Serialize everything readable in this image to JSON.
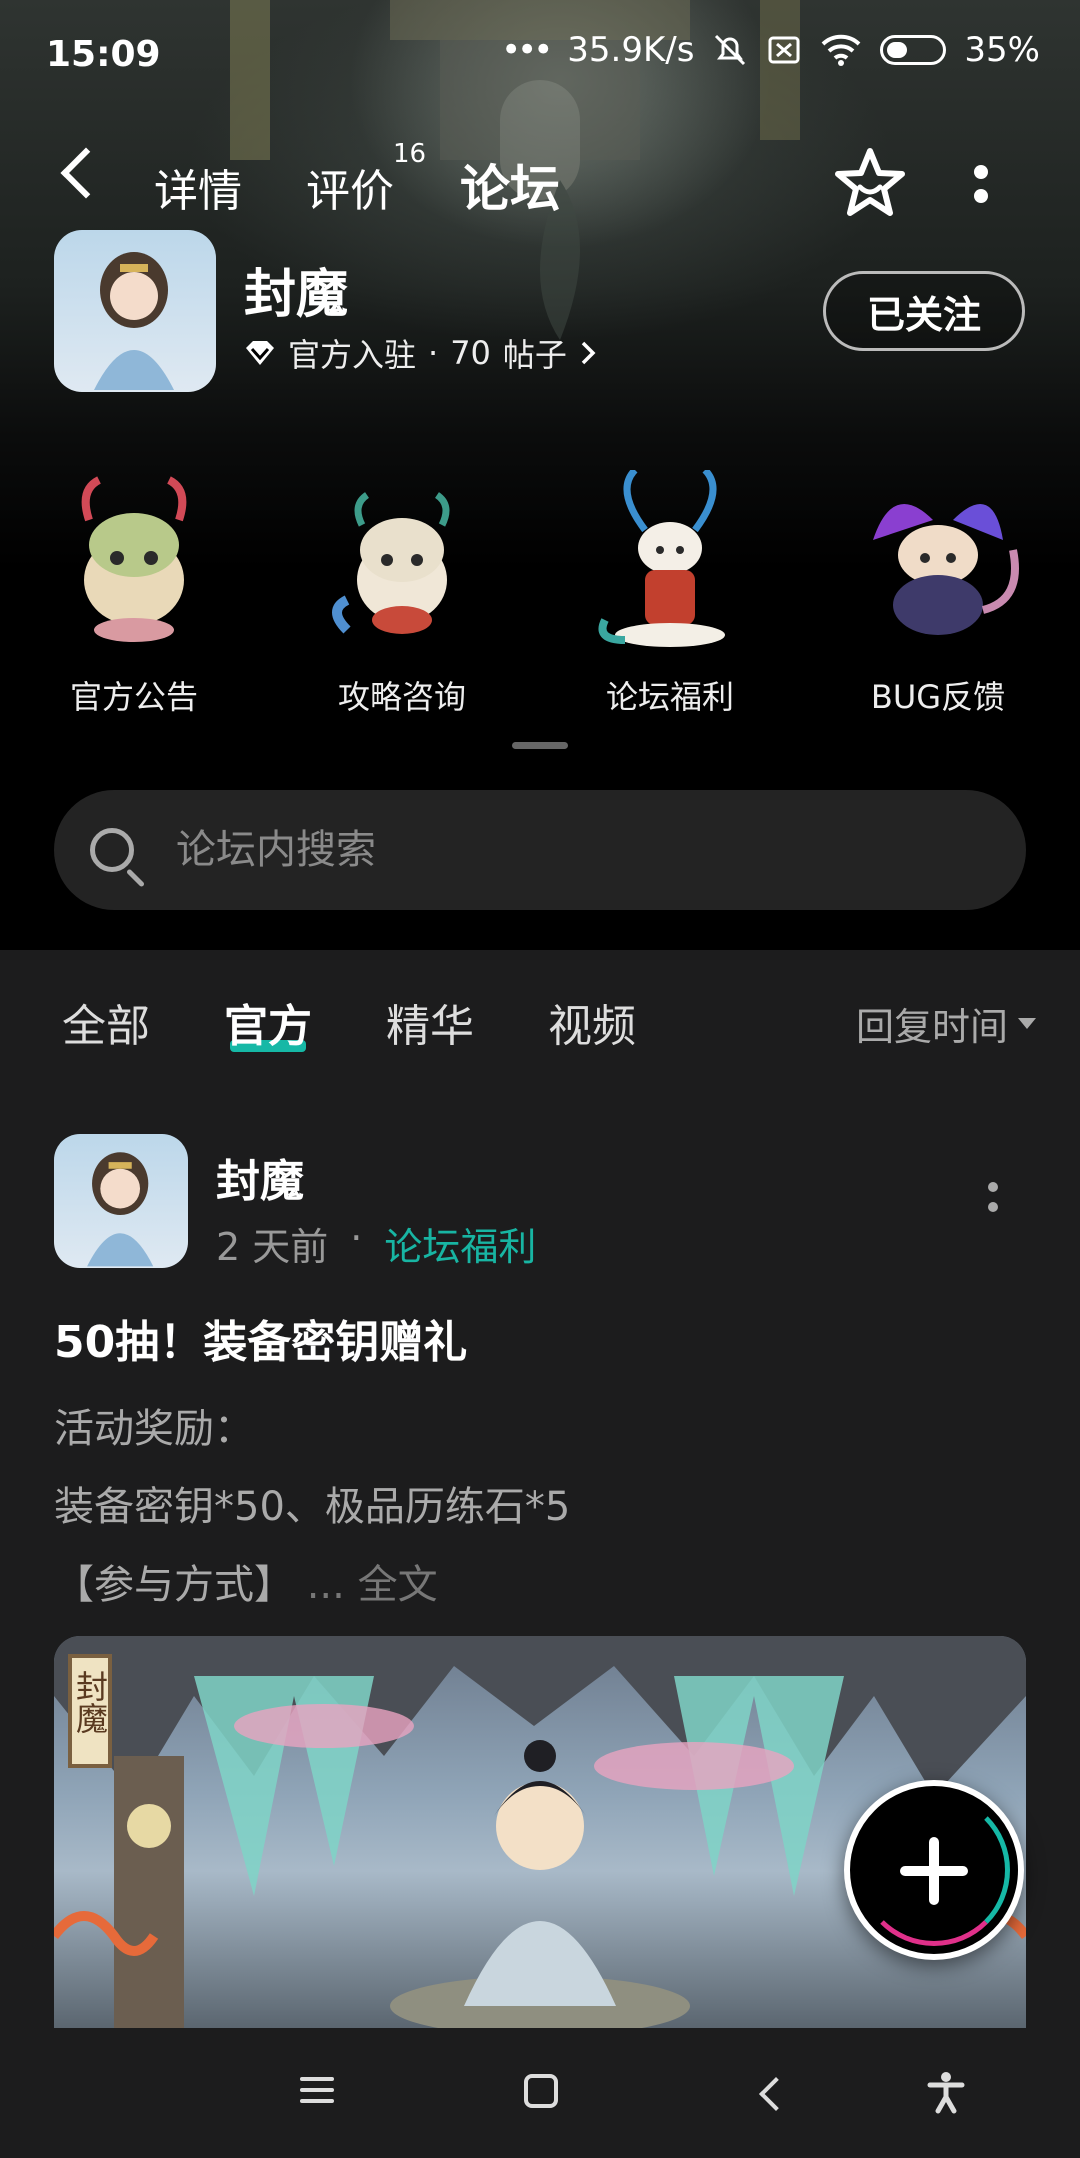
{
  "status_bar": {
    "time": "15:09",
    "speed": "35.9K/s",
    "battery": "35%"
  },
  "nav": {
    "tabs": [
      {
        "label": "详情"
      },
      {
        "label": "评价",
        "badge": "16"
      },
      {
        "label": "论坛"
      }
    ],
    "active_tab": "论坛"
  },
  "app": {
    "name": "封魔",
    "badge_label": "官方入驻",
    "separator": "·",
    "posts_count": "70",
    "posts_unit": "帖子",
    "follow_label": "已关注"
  },
  "categories": [
    {
      "label": "官方公告"
    },
    {
      "label": "攻略咨询"
    },
    {
      "label": "论坛福利"
    },
    {
      "label": "BUG反馈"
    }
  ],
  "search": {
    "placeholder": "论坛内搜索"
  },
  "filters": {
    "tabs": [
      {
        "label": "全部"
      },
      {
        "label": "官方"
      },
      {
        "label": "精华"
      },
      {
        "label": "视频"
      }
    ],
    "active": "官方",
    "sort_label": "回复时间"
  },
  "post": {
    "author": "封魔",
    "time": "2 天前",
    "separator": "·",
    "tag": "论坛福利",
    "title": "50抽！装备密钥赠礼",
    "body_line1": "活动奖励：",
    "body_line2": "装备密钥*50、极品历练石*5",
    "body_line3": "【参与方式】",
    "ellipsis": "...",
    "read_more": "全文",
    "image_caption": "封魔"
  },
  "colors": {
    "accent": "#16b8a6",
    "background": "#1c1c1d"
  }
}
